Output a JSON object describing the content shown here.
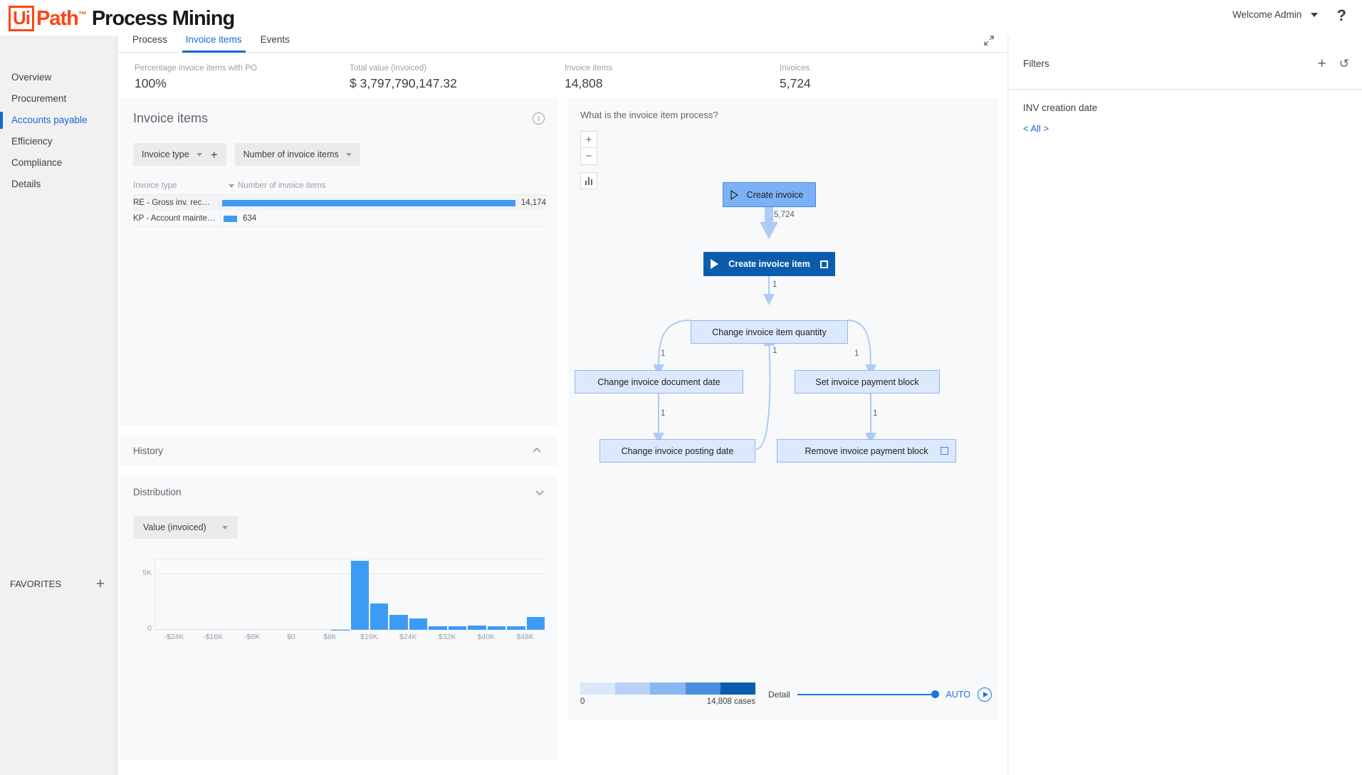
{
  "header": {
    "brand_ui": "Ui",
    "brand_path": "Path",
    "brand_product": "Process Mining",
    "welcome": "Welcome Admin",
    "help": "?"
  },
  "sidebar": {
    "items": [
      {
        "label": "Overview",
        "active": false
      },
      {
        "label": "Procurement",
        "active": false
      },
      {
        "label": "Accounts payable",
        "active": true
      },
      {
        "label": "Efficiency",
        "active": false
      },
      {
        "label": "Compliance",
        "active": false
      },
      {
        "label": "Details",
        "active": false
      }
    ],
    "favorites_label": "FAVORITES",
    "favorites_add": "+"
  },
  "tabs": [
    {
      "label": "Process",
      "active": false
    },
    {
      "label": "Invoice items",
      "active": true
    },
    {
      "label": "Events",
      "active": false
    }
  ],
  "kpis": [
    {
      "label": "Percentage invoice items with PO",
      "value": "100%"
    },
    {
      "label": "Total value (invoiced)",
      "value": "$ 3,797,790,147.32"
    },
    {
      "label": "Invoice items",
      "value": "14,808"
    },
    {
      "label": "Invoices",
      "value": "5,724"
    }
  ],
  "invoice_items_card": {
    "title": "Invoice items",
    "selector_dimension": "Invoice type",
    "selector_add": "+",
    "selector_measure": "Number of invoice items",
    "col_category": "Invoice type",
    "col_value": "Number of invoice items",
    "chart_data": {
      "type": "bar",
      "title": "Invoice items",
      "xlabel": "Number of invoice items",
      "ylabel": "Invoice type",
      "categories": [
        "RE - Gross inv. receipt",
        "KP - Account maintenan..."
      ],
      "values": [
        14174,
        634
      ],
      "value_labels": [
        "14,174",
        "634"
      ],
      "max": 14174,
      "color": "#3e9bf5",
      "orientation": "horizontal"
    }
  },
  "history_card": {
    "title": "History"
  },
  "distribution_card": {
    "title": "Distribution",
    "selector": "Value (invoiced)",
    "chart_data": {
      "type": "bar",
      "title": "Distribution",
      "xlabel": "Value (invoiced)",
      "ylabel": "",
      "ylim": [
        0,
        6000
      ],
      "ytick_labels": [
        "5K",
        "0"
      ],
      "xtick_labels": [
        "-$24K",
        "-$16K",
        "-$8K",
        "$0",
        "$8K",
        "$16K",
        "$24K",
        "$32K",
        "$40K",
        "$48K"
      ],
      "bin_values": [
        0,
        0,
        0,
        0,
        0,
        0,
        0,
        0,
        0,
        30,
        5800,
        2250,
        1280,
        950,
        300,
        290,
        380,
        330,
        300,
        1100
      ],
      "color": "#3e9bf5"
    }
  },
  "process_card": {
    "question": "What is the invoice item process?",
    "zoom_in": "+",
    "zoom_out": "−",
    "graph": {
      "nodes": [
        {
          "id": "create_invoice",
          "label": "Create invoice",
          "style": "light",
          "start": true,
          "end": false
        },
        {
          "id": "create_invoice_item",
          "label": "Create invoice item",
          "style": "dark",
          "start": true,
          "end": true
        },
        {
          "id": "change_qty",
          "label": "Change invoice item quantity",
          "style": "pale",
          "start": false,
          "end": false
        },
        {
          "id": "change_doc_date",
          "label": "Change invoice document date",
          "style": "pale",
          "start": false,
          "end": false
        },
        {
          "id": "set_block",
          "label": "Set invoice payment block",
          "style": "pale",
          "start": false,
          "end": false
        },
        {
          "id": "change_post_date",
          "label": "Change invoice posting date",
          "style": "pale",
          "start": false,
          "end": false
        },
        {
          "id": "remove_block",
          "label": "Remove invoice payment block",
          "style": "pale",
          "start": false,
          "end": true
        }
      ],
      "edge_labels": [
        "5,724",
        "1",
        "1",
        "1",
        "1",
        "1",
        "1"
      ]
    },
    "legend": {
      "min": "0",
      "max": "14,808 cases",
      "colors": [
        "#dbe8fa",
        "#b8d3f7",
        "#8ab6f2",
        "#4a8fe0",
        "#0b5cad"
      ]
    },
    "detail_label": "Detail",
    "auto_label": "AUTO"
  },
  "filters_panel": {
    "title": "Filters",
    "add": "+",
    "reset": "↺",
    "groups": [
      {
        "label": "INV creation date",
        "value": "< All >"
      }
    ]
  }
}
